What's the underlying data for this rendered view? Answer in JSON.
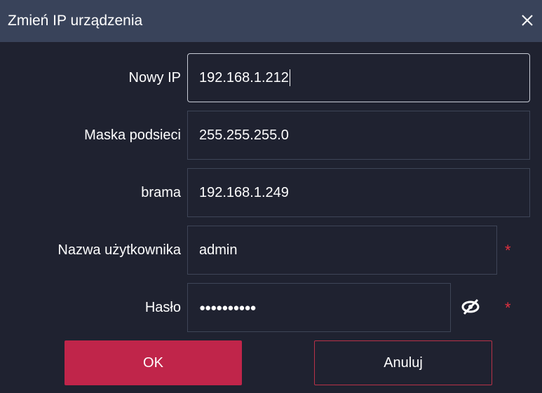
{
  "dialog": {
    "title": "Zmień IP urządzenia",
    "close_icon": "close-icon"
  },
  "form": {
    "new_ip": {
      "label": "Nowy IP",
      "value": "192.168.1.212"
    },
    "subnet_mask": {
      "label": "Maska podsieci",
      "value": "255.255.255.0"
    },
    "gateway": {
      "label": "brama",
      "value": "192.168.1.249"
    },
    "username": {
      "label": "Nazwa użytkownika",
      "value": "admin",
      "required_mark": "*"
    },
    "password": {
      "label": "Hasło",
      "value": "●●●●●●●●●●",
      "required_mark": "*",
      "toggle_icon": "eye-slash-icon"
    }
  },
  "buttons": {
    "ok_label": "OK",
    "cancel_label": "Anuluj"
  },
  "colors": {
    "background": "#1f2230",
    "titlebar": "#39435a",
    "accent": "#c0254a",
    "required": "#e0303f"
  }
}
